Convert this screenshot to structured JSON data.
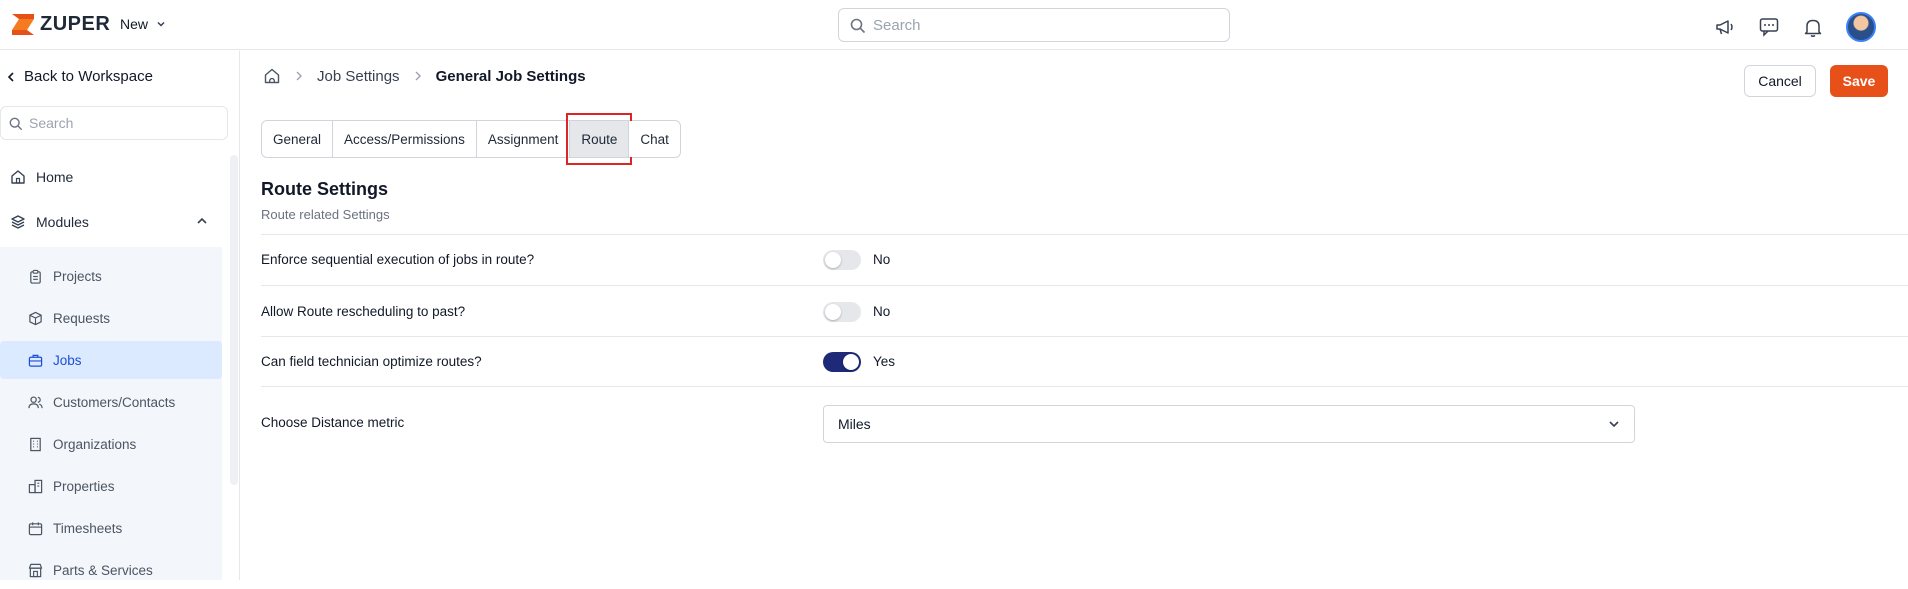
{
  "topbar": {
    "logo_text": "ZUPER",
    "new_label": "New",
    "search_placeholder": "Search"
  },
  "sidebar": {
    "back_label": "Back to Workspace",
    "search_placeholder": "Search",
    "home_label": "Home",
    "modules_label": "Modules",
    "sub_items": [
      {
        "label": "Projects",
        "icon": "clipboard-icon"
      },
      {
        "label": "Requests",
        "icon": "box-icon"
      },
      {
        "label": "Jobs",
        "icon": "briefcase-icon",
        "active": true
      },
      {
        "label": "Customers/Contacts",
        "icon": "users-icon"
      },
      {
        "label": "Organizations",
        "icon": "building-icon"
      },
      {
        "label": "Properties",
        "icon": "property-icon"
      },
      {
        "label": "Timesheets",
        "icon": "calendar-icon"
      },
      {
        "label": "Parts & Services",
        "icon": "store-icon"
      }
    ]
  },
  "breadcrumb": {
    "items": [
      "Job Settings",
      "General Job Settings"
    ]
  },
  "actions": {
    "cancel_label": "Cancel",
    "save_label": "Save"
  },
  "tabs": [
    {
      "label": "General"
    },
    {
      "label": "Access/Permissions"
    },
    {
      "label": "Assignment"
    },
    {
      "label": "Route",
      "active": true
    },
    {
      "label": "Chat"
    }
  ],
  "section": {
    "title": "Route Settings",
    "subtitle": "Route related Settings"
  },
  "settings": [
    {
      "label": "Enforce sequential execution of jobs in route?",
      "state": "No",
      "on": false
    },
    {
      "label": "Allow Route rescheduling to past?",
      "state": "No",
      "on": false
    },
    {
      "label": "Can field technician optimize routes?",
      "state": "Yes",
      "on": true
    }
  ],
  "distance": {
    "label": "Choose Distance metric",
    "value": "Miles"
  },
  "colors": {
    "accent": "#e8501a",
    "toggle_on": "#1e2a78",
    "active_nav": "#dbeafe"
  }
}
